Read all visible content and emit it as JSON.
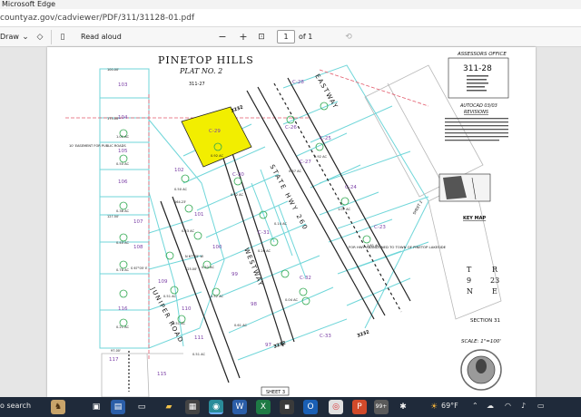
{
  "window": {
    "title": "Microsoft Edge"
  },
  "address": {
    "url": "countyaz.gov/cadviewer/PDF/311/31128-01.pdf"
  },
  "pdf_toolbar": {
    "draw_label": "Draw",
    "read_aloud_label": "Read aloud",
    "zoom_out": "−",
    "zoom_in": "+",
    "page_number": "1",
    "page_count": "of 1"
  },
  "plat": {
    "title": "PINETOP HILLS",
    "subtitle": "PLAT NO. 2",
    "header_ref": "311-27",
    "office": "ASSESSORS OFFICE",
    "book": "311-28",
    "autocad": "AUTOCAD 03/03",
    "revisions": "REVISIONS",
    "key_map": "KEY MAP",
    "section": "SECTION 31",
    "scale": "SCALE: 1\"=100'",
    "sheet": "SHEET 3",
    "sheet_side": "SHEET 2",
    "township": [
      "T",
      "9",
      "N"
    ],
    "range": [
      "R",
      "23",
      "E"
    ],
    "roads": {
      "juniper": "JUNIPER ROAD",
      "westway": "WESTWAY",
      "state_hwy": "STATE HWY 260",
      "eastway": "EASTWAY"
    },
    "abandon_note": "FOR HWY ABANDONED TO TOWN OF PINETOP LAKESIDE",
    "numbers": [
      "3232",
      "3232",
      "3232"
    ],
    "lots": [
      {
        "id": "103"
      },
      {
        "id": "104",
        "area": "1.01 AC"
      },
      {
        "id": "105",
        "area": "0.50 AC"
      },
      {
        "id": "106",
        "area": "0.36 AC"
      },
      {
        "id": "107",
        "area": "0.40 AC"
      },
      {
        "id": "108",
        "area": "0.78 AC"
      },
      {
        "id": "109",
        "area": "0.51 AC"
      },
      {
        "id": "110",
        "area": "0.51 AC"
      },
      {
        "id": "111",
        "area": "0.51 AC"
      },
      {
        "id": "116",
        "area": "0.21 AC"
      },
      {
        "id": "117"
      },
      {
        "id": "115"
      },
      {
        "id": "102",
        "area": "0.50 AC"
      },
      {
        "id": "101",
        "area": "0.43 AC"
      },
      {
        "id": "100",
        "area": "0.52 AC"
      },
      {
        "id": "99",
        "area": "0.52 AC"
      },
      {
        "id": "98",
        "area": "0.61 AC"
      },
      {
        "id": "97"
      },
      {
        "id": "C-29",
        "area": "0.92 AC"
      },
      {
        "id": "C-30",
        "area": "0.92 AC"
      },
      {
        "id": "C-31",
        "area": "0.26 AC"
      },
      {
        "id": "C-32",
        "area": "0.04 AC"
      },
      {
        "id": "C-33"
      },
      {
        "id": "C-25",
        "area": "0.92 AC"
      },
      {
        "id": "C-24",
        "area": "1.07 AC"
      },
      {
        "id": "C-23",
        "area": "1.61 AC"
      },
      {
        "id": "C-28"
      },
      {
        "id": "C-27",
        "area": "0.37 AC"
      },
      {
        "id": "C-26",
        "area": "0.14 AC"
      }
    ],
    "road_note": "10' EASEMENT FOR PUBLIC ROADS",
    "dims": [
      "100.00'",
      "175.00'",
      "164.23'",
      "127.50'",
      "125.00'",
      "97.00'",
      "S 67°05' E",
      "N 67°05' W"
    ]
  },
  "taskbar": {
    "weather": "69°F",
    "badge": "99+",
    "search_tail": "o search"
  },
  "colors": {
    "highlight_lot": "#f2ee00",
    "parcel_line": "#6fd6d9",
    "boundary": "#e35a6b",
    "taskbar": "#1f2a3a",
    "seal": "#6a6a6a"
  }
}
